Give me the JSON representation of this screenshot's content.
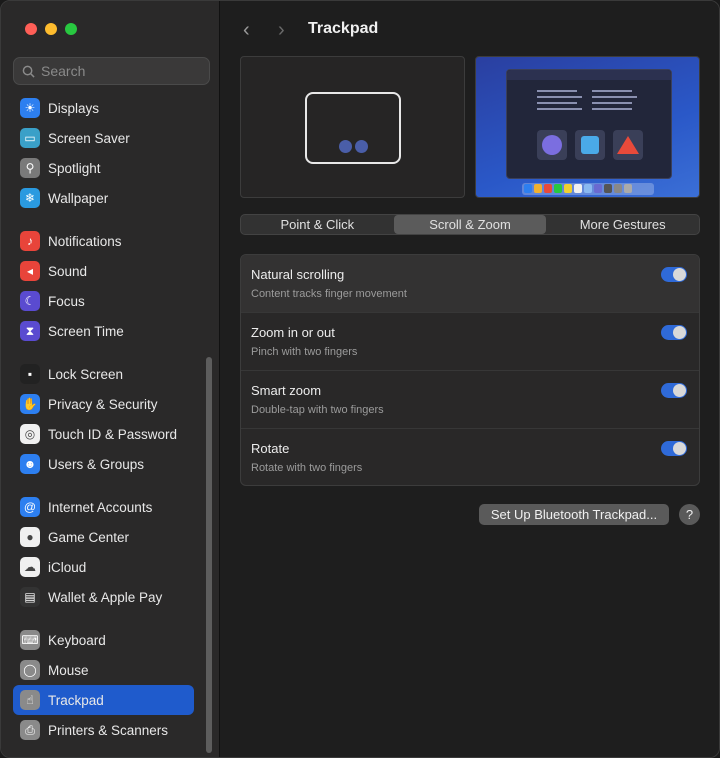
{
  "search": {
    "placeholder": "Search"
  },
  "sidebar": {
    "items": [
      {
        "label": "Displays",
        "icon": "sun-icon",
        "color": "#2d7ff0"
      },
      {
        "label": "Screen Saver",
        "icon": "screensaver-icon",
        "color": "#3aa0c8"
      },
      {
        "label": "Spotlight",
        "icon": "magnifier-icon",
        "color": "#7a7a7a"
      },
      {
        "label": "Wallpaper",
        "icon": "snowflake-icon",
        "color": "#2a9ae0"
      },
      {
        "label": "Notifications",
        "icon": "bell-icon",
        "color": "#e8443a"
      },
      {
        "label": "Sound",
        "icon": "speaker-icon",
        "color": "#e8443a"
      },
      {
        "label": "Focus",
        "icon": "moon-icon",
        "color": "#5a4bd0"
      },
      {
        "label": "Screen Time",
        "icon": "hourglass-icon",
        "color": "#5a4bd0"
      },
      {
        "label": "Lock Screen",
        "icon": "lock-icon",
        "color": "#222222"
      },
      {
        "label": "Privacy & Security",
        "icon": "hand-icon",
        "color": "#2d7ff0"
      },
      {
        "label": "Touch ID & Password",
        "icon": "fingerprint-icon",
        "color": "#f0f0f0"
      },
      {
        "label": "Users & Groups",
        "icon": "users-icon",
        "color": "#2d7ff0"
      },
      {
        "label": "Internet Accounts",
        "icon": "at-icon",
        "color": "#2d7ff0"
      },
      {
        "label": "Game Center",
        "icon": "gamecenter-icon",
        "color": "#f0f0f0"
      },
      {
        "label": "iCloud",
        "icon": "cloud-icon",
        "color": "#f0f0f0"
      },
      {
        "label": "Wallet & Apple Pay",
        "icon": "wallet-icon",
        "color": "#333333"
      },
      {
        "label": "Keyboard",
        "icon": "keyboard-icon",
        "color": "#8a8a8a"
      },
      {
        "label": "Mouse",
        "icon": "mouse-icon",
        "color": "#8a8a8a"
      },
      {
        "label": "Trackpad",
        "icon": "trackpad-icon",
        "color": "#8a8a8a"
      },
      {
        "label": "Printers & Scanners",
        "icon": "printer-icon",
        "color": "#8a8a8a"
      }
    ]
  },
  "header": {
    "title": "Trackpad"
  },
  "tabs": [
    "Point & Click",
    "Scroll & Zoom",
    "More Gestures"
  ],
  "settings": [
    {
      "title": "Natural scrolling",
      "subtitle": "Content tracks finger movement",
      "enabled": true
    },
    {
      "title": "Zoom in or out",
      "subtitle": "Pinch with two fingers",
      "enabled": true
    },
    {
      "title": "Smart zoom",
      "subtitle": "Double-tap with two fingers",
      "enabled": true
    },
    {
      "title": "Rotate",
      "subtitle": "Rotate with two fingers",
      "enabled": true
    }
  ],
  "footer": {
    "bluetooth_button": "Set Up Bluetooth Trackpad...",
    "help": "?"
  },
  "colors": {
    "accent": "#1f5bcc",
    "toggle_on": "#2f6ad8"
  }
}
